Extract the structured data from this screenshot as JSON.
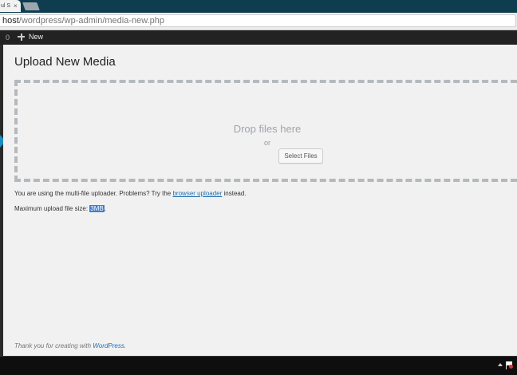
{
  "browser": {
    "tab_title": "ul S",
    "tab_close": "×",
    "url_host": "host",
    "url_path": "/wordpress/wp-admin/media-new.php"
  },
  "adminbar": {
    "count": "0",
    "new_label": "New"
  },
  "page": {
    "title": "Upload New Media",
    "drop_title": "Drop files here",
    "drop_or": "or",
    "select_files": "Select Files",
    "info_prefix": "You are using the multi-file uploader. Problems? Try the ",
    "info_link": "browser uploader",
    "info_suffix": " instead.",
    "max_prefix": "Maximum upload file size: ",
    "max_value": "3MB",
    "max_suffix": ".",
    "footer_prefix": "Thank you for creating with ",
    "footer_link": "WordPress",
    "footer_suffix": "."
  },
  "colors": {
    "admin_bar": "#222222",
    "link": "#1e6fb3",
    "highlight": "#3b7fd1",
    "menu_arrow": "#1b8fc1"
  }
}
